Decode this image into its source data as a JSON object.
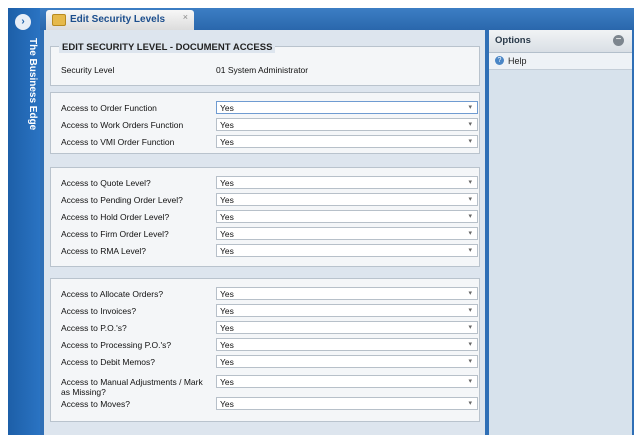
{
  "sidebar": {
    "app_title": "The Business Edge",
    "nav_glyph": "›"
  },
  "tab": {
    "label": "Edit Security Levels",
    "close_glyph": "×"
  },
  "form": {
    "title": "EDIT SECURITY LEVEL - DOCUMENT ACCESS",
    "security_level_label": "Security Level",
    "security_level_value": "01 System Administrator",
    "group1": [
      {
        "label": "Access to Order Function",
        "value": "Yes"
      },
      {
        "label": "Access to Work Orders Function",
        "value": "Yes"
      },
      {
        "label": "Access to VMI Order Function",
        "value": "Yes"
      }
    ],
    "group2": [
      {
        "label": "Access to Quote Level?",
        "value": "Yes"
      },
      {
        "label": "Access to Pending Order Level?",
        "value": "Yes"
      },
      {
        "label": "Access to Hold Order Level?",
        "value": "Yes"
      },
      {
        "label": "Access to Firm Order Level?",
        "value": "Yes"
      },
      {
        "label": "Access to RMA Level?",
        "value": "Yes"
      }
    ],
    "group3": [
      {
        "label": "Access to Allocate Orders?",
        "value": "Yes"
      },
      {
        "label": "Access to Invoices?",
        "value": "Yes"
      },
      {
        "label": "Access to P.O.'s?",
        "value": "Yes"
      },
      {
        "label": "Access to Processing P.O.'s?",
        "value": "Yes"
      },
      {
        "label": "Access to Debit Memos?",
        "value": "Yes"
      },
      {
        "label": "Access to Manual Adjustments / Mark as Missing?",
        "value": "Yes"
      },
      {
        "label": "Access to Moves?",
        "value": "Yes"
      }
    ],
    "dropdown_arrow": "▾"
  },
  "options": {
    "title": "Options",
    "collapse_glyph": "−",
    "help_label": "Help",
    "help_glyph": "?"
  }
}
